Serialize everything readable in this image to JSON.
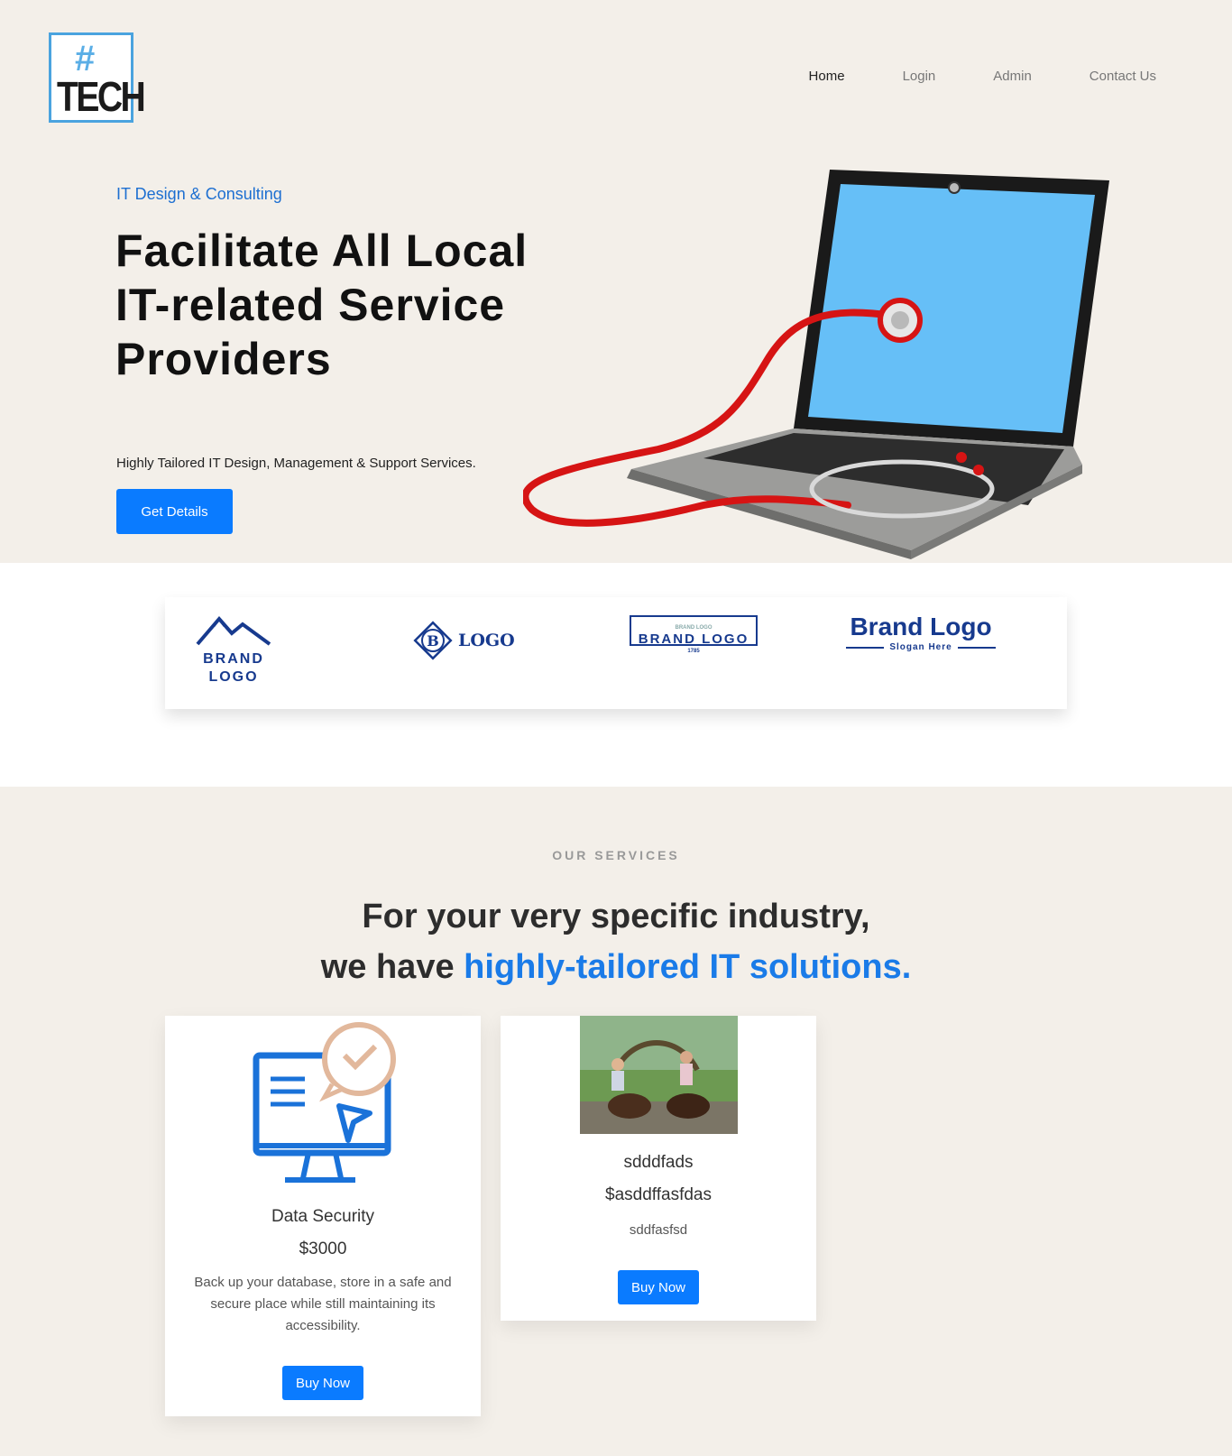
{
  "header": {
    "logo": {
      "hash": "#",
      "text": "TECH"
    },
    "nav": [
      {
        "label": "Home",
        "active": true
      },
      {
        "label": "Login",
        "active": false
      },
      {
        "label": "Admin",
        "active": false
      },
      {
        "label": "Contact Us",
        "active": false
      }
    ]
  },
  "hero": {
    "tagline": "IT Design & Consulting",
    "title": "Facilitate All Local IT-related Service Providers",
    "subtitle": "Highly Tailored IT Design, Management & Support Services.",
    "button": "Get Details"
  },
  "brands": [
    {
      "line1": "BRAND",
      "line2": "LOGO"
    },
    {
      "letter": "B",
      "text": "LOGO"
    },
    {
      "top": "BRAND LOGO",
      "main": "BRAND LOGO",
      "year": "1785"
    },
    {
      "main": "Brand Logo",
      "slogan": "Slogan Here"
    }
  ],
  "services": {
    "label": "OUR SERVICES",
    "heading_line1": "For your very specific industry,",
    "heading_line2_prefix": "we have ",
    "heading_line2_accent": "highly-tailored IT solutions.",
    "cards": [
      {
        "name": "Data Security",
        "price": "$3000",
        "description": "Back up your database, store in a safe and secure place while still maintaining its accessibility.",
        "button": "Buy Now"
      },
      {
        "name": "sdddfads",
        "price": "$asddffasfdas",
        "description": "sddfasfsd",
        "button": "Buy Now"
      }
    ]
  },
  "colors": {
    "accent": "#0a7bff",
    "background": "#f3efe9",
    "brand_blue": "#173a8e"
  }
}
